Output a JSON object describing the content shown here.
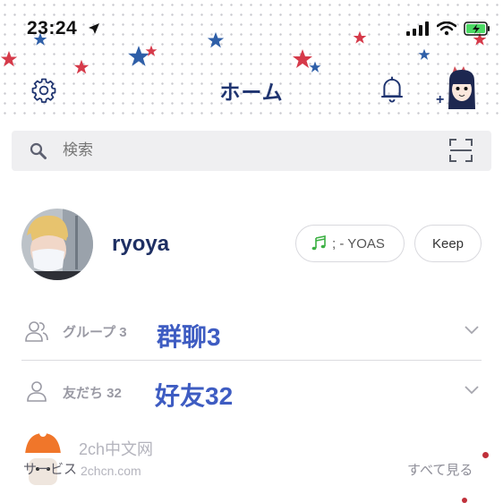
{
  "status_bar": {
    "time": "23:24"
  },
  "header": {
    "title": "ホーム"
  },
  "search": {
    "placeholder": "検索"
  },
  "profile": {
    "name": "ryoya",
    "music_text": "; - YOAS",
    "keep_label": "Keep"
  },
  "sections": {
    "groups": {
      "label": "グループ 3",
      "annotation": "群聊3"
    },
    "friends": {
      "label": "友だち 32",
      "annotation": "好友32"
    }
  },
  "services": {
    "label": "サービス",
    "see_all": "すべて見る"
  },
  "watermark": {
    "line1": "2ch中文网",
    "line2": "2chcn.com"
  },
  "colors": {
    "title": "#1f3470",
    "annotation": "#3e5cc2",
    "star_red": "#d63a4a",
    "star_blue": "#2f5fa8"
  }
}
